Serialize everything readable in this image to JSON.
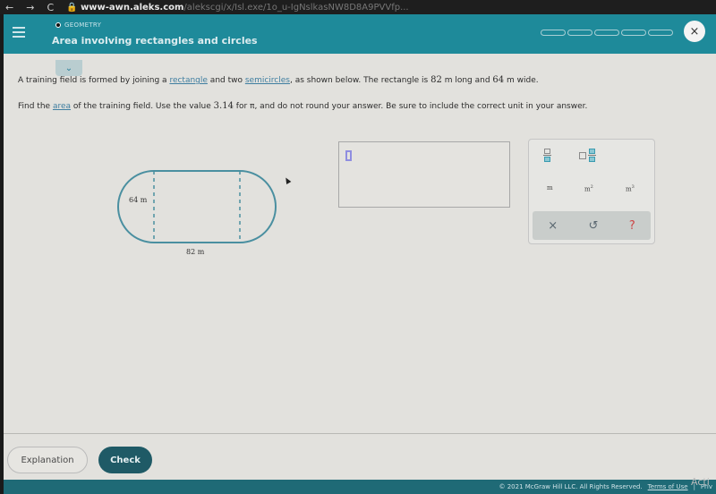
{
  "browser": {
    "back_icon": "arrow-left-icon",
    "forward_icon": "arrow-right-icon",
    "reload_icon": "reload-icon",
    "url_domain": "www-awn.aleks.com",
    "url_rest": "/alekscgi/x/Isl.exe/1o_u-IgNslkasNW8D8A9PVVfp..."
  },
  "header": {
    "topic": "GEOMETRY",
    "title": "Area involving rectangles and circles",
    "progress_segments": 5,
    "close_label": "×"
  },
  "question": {
    "line1_a": "A training field is formed by joining a ",
    "line1_link1": "rectangle",
    "line1_b": " and two ",
    "line1_link2": "semicircles",
    "line1_c": ", as shown below. The rectangle is ",
    "length": "82",
    "line1_d": " m long and ",
    "width": "64",
    "line1_e": " m wide.",
    "line2_a": "Find the ",
    "line2_link": "area",
    "line2_b": " of the training field. Use the value ",
    "pi_value": "3.14",
    "line2_c": " for π, and do not round your answer. Be sure to include the correct unit in your answer."
  },
  "figure": {
    "width_label": "64 m",
    "length_label": "82 m"
  },
  "answer": {
    "value": ""
  },
  "keypad": {
    "fraction_icon": "fraction-icon",
    "mixed_number_icon": "mixed-number-icon",
    "unit_m": "m",
    "unit_m2": "m",
    "unit_m3": "m",
    "sup2": "2",
    "sup3": "3",
    "clear": "×",
    "undo": "↺",
    "help": "?"
  },
  "footer": {
    "explanation_label": "Explanation",
    "check_label": "Check",
    "copyright": "© 2021 McGraw Hill LLC. All Rights Reserved.",
    "terms": "Terms of Use",
    "separator": "|",
    "privacy": "Priv",
    "watermark": "Acti"
  }
}
